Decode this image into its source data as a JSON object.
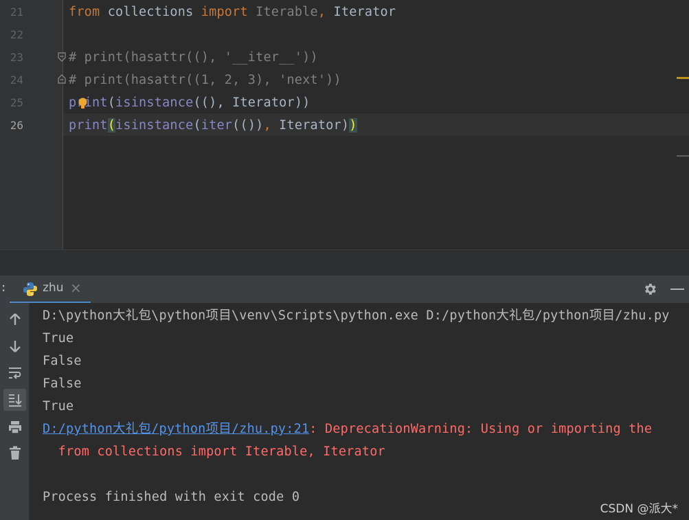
{
  "editor": {
    "line_numbers": [
      "21",
      "22",
      "23",
      "24",
      "25",
      "26"
    ],
    "lines": [
      {
        "number": "21",
        "tokens": [
          {
            "t": "from",
            "c": "kw"
          },
          {
            "t": " collections ",
            "c": "mod"
          },
          {
            "t": "import",
            "c": "kw"
          },
          {
            "t": " Iterable",
            "c": "unused"
          },
          {
            "t": ",",
            "c": "kw"
          },
          {
            "t": " Iterator",
            "c": "mod"
          }
        ]
      },
      {
        "number": "22",
        "tokens": []
      },
      {
        "number": "23",
        "tokens": [
          {
            "t": "# print(hasattr((), '__iter__'))",
            "c": "cm"
          }
        ]
      },
      {
        "number": "24",
        "tokens": [
          {
            "t": "# print(hasattr((1, 2, 3), 'next'))",
            "c": "cm"
          }
        ]
      },
      {
        "number": "25",
        "tokens": [
          {
            "t": "print",
            "c": "bi"
          },
          {
            "t": "(",
            "c": "mod"
          },
          {
            "t": "isinstance",
            "c": "bi"
          },
          {
            "t": "((), Iterator))",
            "c": "mod"
          }
        ]
      },
      {
        "number": "26",
        "tokens": [
          {
            "t": "print",
            "c": "bi"
          },
          {
            "t": "(",
            "c": "br"
          },
          {
            "t": "isinstance",
            "c": "bi"
          },
          {
            "t": "(",
            "c": "mod"
          },
          {
            "t": "iter",
            "c": "bi"
          },
          {
            "t": "(())",
            "c": "mod"
          },
          {
            "t": ",",
            "c": "kw"
          },
          {
            "t": " Iterator)",
            "c": "mod"
          },
          {
            "t": ")",
            "c": "br"
          }
        ]
      }
    ]
  },
  "run_panel": {
    "left_marker": ":",
    "tab_label": "zhu",
    "tab_close": "×"
  },
  "console": {
    "lines": [
      {
        "parts": [
          {
            "t": "D:\\python大礼包\\python项目\\venv\\Scripts\\python.exe D:/python大礼包/python项目/zhu.py",
            "c": ""
          }
        ]
      },
      {
        "parts": [
          {
            "t": "True",
            "c": ""
          }
        ]
      },
      {
        "parts": [
          {
            "t": "False",
            "c": ""
          }
        ]
      },
      {
        "parts": [
          {
            "t": "False",
            "c": ""
          }
        ]
      },
      {
        "parts": [
          {
            "t": "True",
            "c": ""
          }
        ]
      },
      {
        "parts": [
          {
            "t": "D:/python大礼包/python项目/zhu.py:21",
            "c": "link"
          },
          {
            "t": ": DeprecationWarning: Using or importing the",
            "c": "err"
          }
        ]
      },
      {
        "parts": [
          {
            "t": "  from collections import Iterable, Iterator",
            "c": "err"
          }
        ]
      },
      {
        "parts": []
      },
      {
        "parts": [
          {
            "t": "Process finished with exit code 0",
            "c": ""
          }
        ]
      }
    ]
  },
  "watermark": "CSDN @派大*",
  "colors": {
    "keyword": "#cc7832",
    "builtin": "#8888c6",
    "comment": "#808080",
    "error": "#ff6b68",
    "link": "#5394ec",
    "tab_underline": "#4a88c7"
  }
}
